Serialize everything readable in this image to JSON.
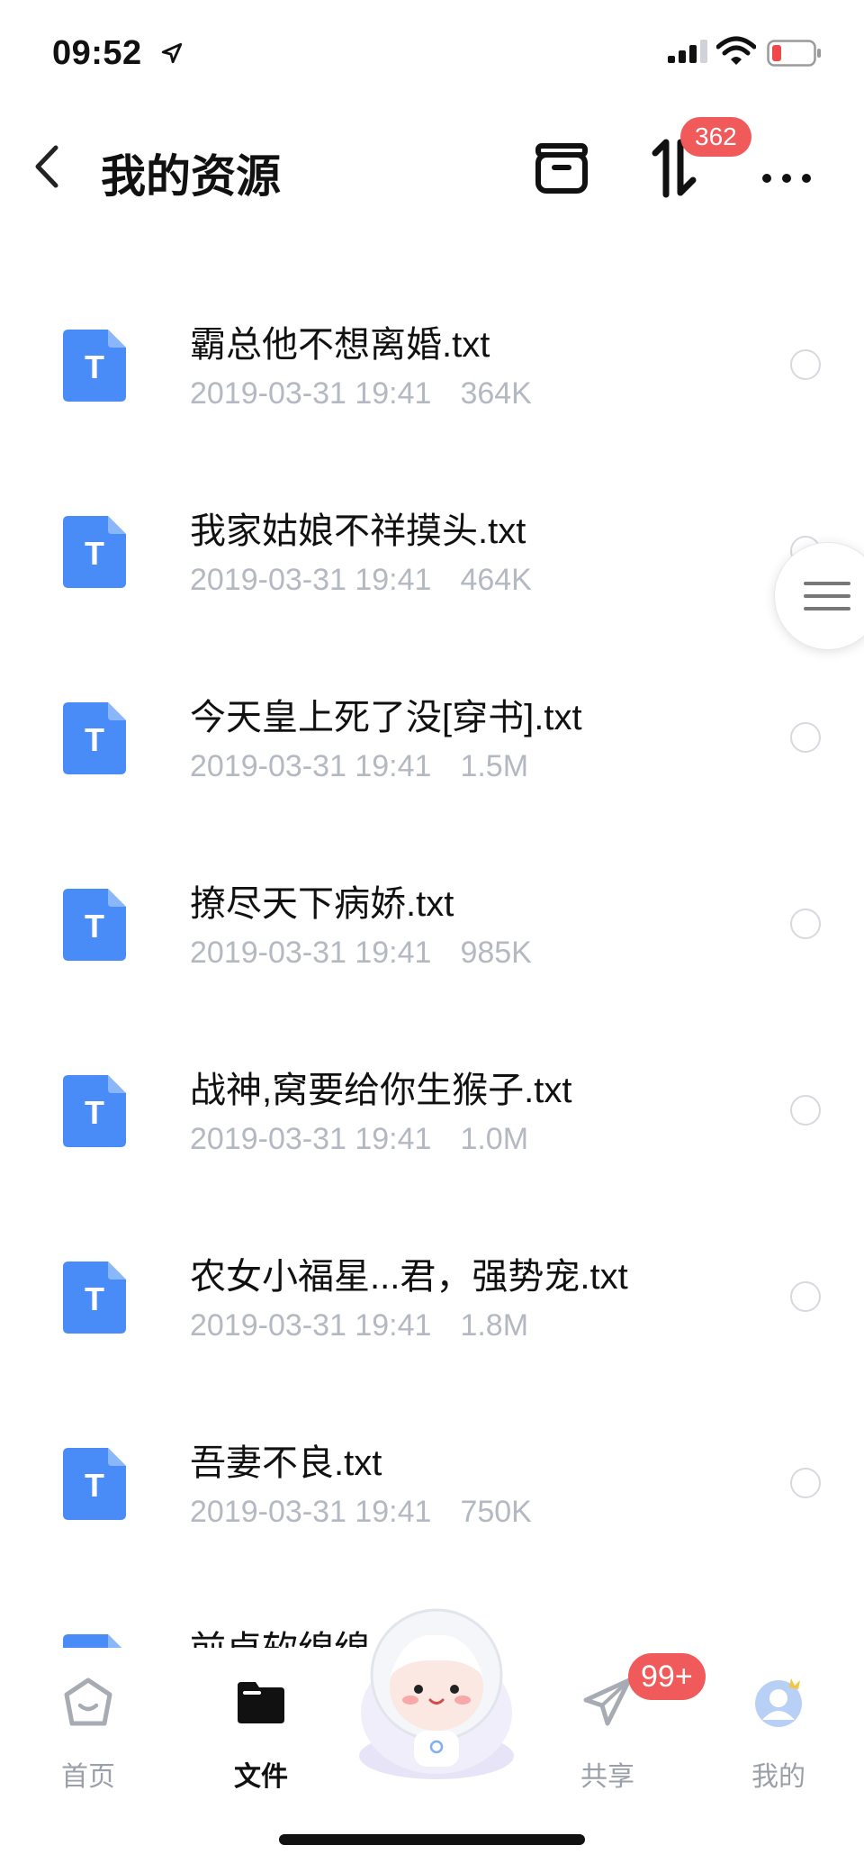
{
  "status_bar": {
    "time": "09:52",
    "colors": {
      "battery_low": "#f04848"
    }
  },
  "header": {
    "title": "我的资源",
    "transfer_badge": "362",
    "icons": [
      "back-icon",
      "recycle-bin-icon",
      "transfer-icon",
      "more-icon"
    ]
  },
  "files": [
    {
      "name": "霸总他不想离婚.txt",
      "date": "2019-03-31 19:41",
      "size": "364K"
    },
    {
      "name": "我家姑娘不祥摸头.txt",
      "date": "2019-03-31 19:41",
      "size": "464K"
    },
    {
      "name": "今天皇上死了没[穿书].txt",
      "date": "2019-03-31 19:41",
      "size": "1.5M"
    },
    {
      "name": "撩尽天下病娇.txt",
      "date": "2019-03-31 19:41",
      "size": "985K"
    },
    {
      "name": "战神,窝要给你生猴子.txt",
      "date": "2019-03-31 19:41",
      "size": "1.0M"
    },
    {
      "name": "农女小福星...君，强势宠.txt",
      "date": "2019-03-31 19:41",
      "size": "1.8M"
    },
    {
      "name": "吾妻不良.txt",
      "date": "2019-03-31 19:41",
      "size": "750K"
    },
    {
      "name": "前卓软绵绵",
      "date": "",
      "size": ""
    }
  ],
  "file_icon_letter": "T",
  "tab_bar": {
    "home": "首页",
    "files": "文件",
    "share": "共享",
    "me": "我的",
    "share_badge": "99+"
  },
  "colors": {
    "accent_blue": "#4a8cf7",
    "badge_red": "#f05a5a",
    "meta_gray": "#b3b8c2"
  }
}
